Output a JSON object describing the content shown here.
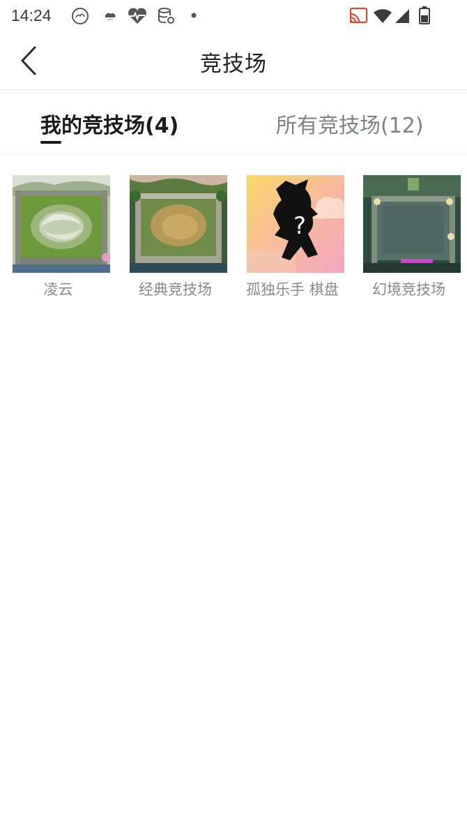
{
  "status_bar": {
    "time": "14:24",
    "left_icons": [
      "cloud-face-icon",
      "weather-icon",
      "heart-rate-icon",
      "database-settings-icon",
      "dot-icon"
    ],
    "right_icons": [
      "cast-icon",
      "wifi-icon",
      "cell-signal-icon",
      "battery-icon"
    ]
  },
  "header": {
    "title": "竞技场",
    "back_icon": "chevron-left-icon"
  },
  "tabs": [
    {
      "label": "我的竞技场(4)",
      "active": true
    },
    {
      "label": "所有竞技场(12)",
      "active": false
    }
  ],
  "arenas": [
    {
      "name": "凌云",
      "thumbnail": "green-arena-swirl"
    },
    {
      "name": "经典竞技场",
      "thumbnail": "classic-arena"
    },
    {
      "name": "孤独乐手 棋盘",
      "thumbnail": "unknown-silhouette"
    },
    {
      "name": "幻境竞技场",
      "thumbnail": "dark-mirage-arena"
    }
  ],
  "colors": {
    "title": "#222222",
    "tab_active": "#1b1b1b",
    "tab_inactive": "#7d8285",
    "label": "#8a8a8a"
  }
}
